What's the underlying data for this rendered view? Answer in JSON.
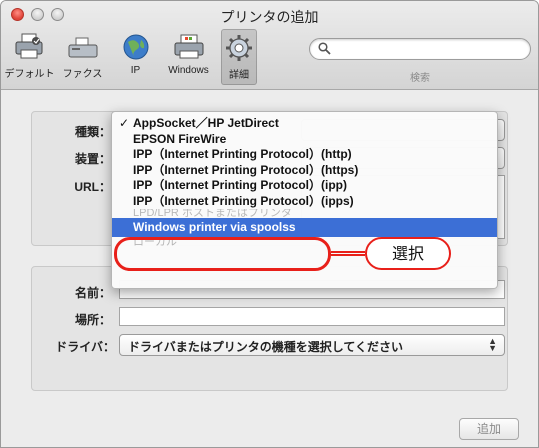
{
  "window": {
    "title": "プリンタの追加"
  },
  "toolbar": {
    "items": [
      {
        "label": "デフォルト",
        "icon": "printer-default-icon"
      },
      {
        "label": "ファクス",
        "icon": "fax-icon"
      },
      {
        "label": "IP",
        "icon": "globe-icon"
      },
      {
        "label": "Windows",
        "icon": "windows-printer-icon"
      },
      {
        "label": "詳細",
        "icon": "advanced-gear-icon",
        "selected": true
      }
    ],
    "search_label": "検索"
  },
  "form": {
    "kind_label": "種類：",
    "device_label": "装置：",
    "url_label": "URL：",
    "name_label": "名前：",
    "location_label": "場所：",
    "driver_label": "ドライバ：",
    "driver_value": "ドライバまたはプリンタの機種を選択してください",
    "add_button": "追加"
  },
  "menu": {
    "items": [
      {
        "label": "AppSocket／HP JetDirect",
        "checked": true
      },
      {
        "label": "EPSON FireWire"
      },
      {
        "label": "IPP（Internet Printing Protocol）(http)"
      },
      {
        "label": "IPP（Internet Printing Protocol）(https)"
      },
      {
        "label": "IPP（Internet Printing Protocol）(ipp)"
      },
      {
        "label": "IPP（Internet Printing Protocol）(ipps)"
      },
      {
        "label": "LPD/LPR ホストまたはプリンタ"
      },
      {
        "label": "Windows printer via spoolss"
      },
      {
        "label": "ローカル"
      }
    ],
    "highlight_color": "#3c6fd6"
  },
  "annotation": {
    "label": "選択",
    "color": "#e8201a"
  }
}
